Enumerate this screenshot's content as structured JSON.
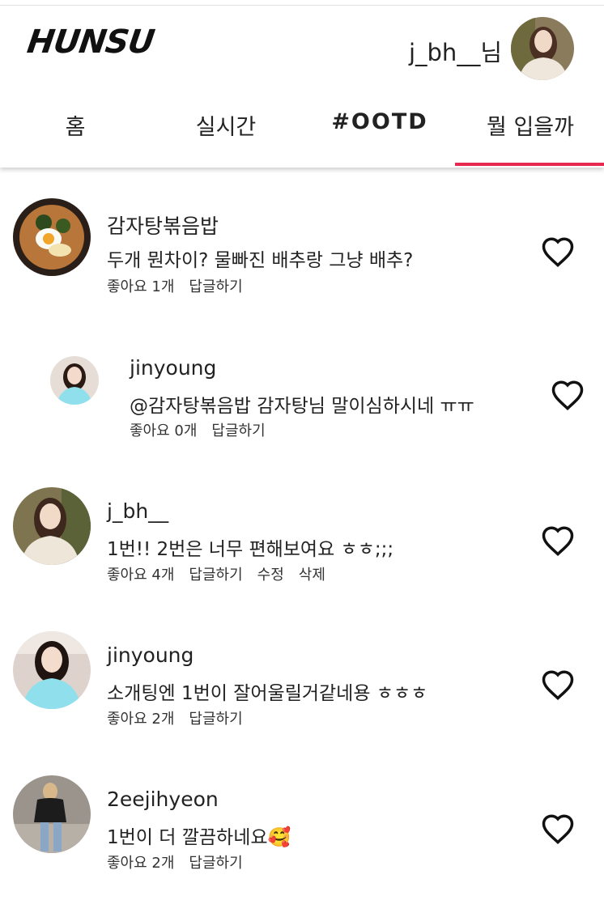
{
  "header": {
    "logo": "HUNSU",
    "user_name": "j_bh__님"
  },
  "tabs": [
    {
      "label": "홈"
    },
    {
      "label": "실시간"
    },
    {
      "label": "#OOTD"
    },
    {
      "label": "뭘 입을까",
      "active": true
    }
  ],
  "colors": {
    "accent": "#e8294f"
  },
  "comments": [
    {
      "author": "감자탕볶음밥",
      "text": "두개 뭔차이? 물빠진 배추랑 그냥 배추?",
      "likes": "좋아요 1개",
      "reply": "답글하기",
      "avatar": "food-rice-avatar"
    },
    {
      "author": "jinyoung",
      "text": "@감자탕볶음밥 감자탕님 말이심하시네 ㅠㅠ",
      "likes": "좋아요 0개",
      "reply": "답글하기",
      "avatar": "woman-avatar"
    },
    {
      "author": "j_bh__",
      "text": "1번!! 2번은 너무 편해보여요 ㅎㅎ;;;",
      "likes": "좋아요 4개",
      "reply": "답글하기",
      "edit": "수정",
      "delete": "삭제",
      "avatar": "woman-avatar"
    },
    {
      "author": "jinyoung",
      "text": "소개팅엔 1번이 잘어울릴거같네용 ㅎㅎㅎ",
      "likes": "좋아요 2개",
      "reply": "답글하기",
      "avatar": "woman-avatar"
    },
    {
      "author": "2eejihyeon",
      "text": "1번이 더 깔끔하네요🥰",
      "likes": "좋아요 2개",
      "reply": "답글하기",
      "avatar": "woman-avatar"
    }
  ]
}
